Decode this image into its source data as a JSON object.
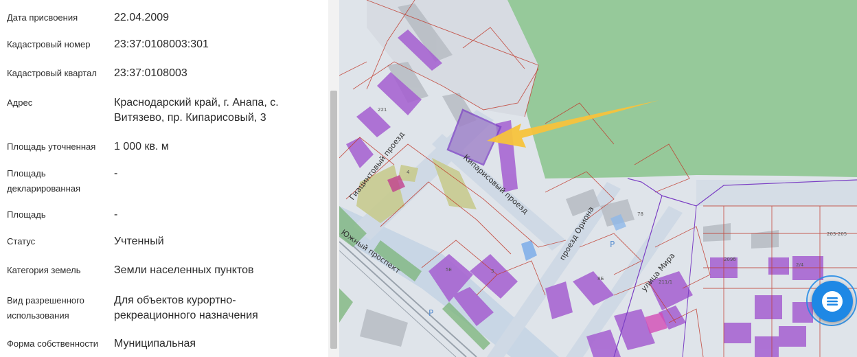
{
  "properties": [
    {
      "label": "Дата присвоения",
      "value": "22.04.2009"
    },
    {
      "label": "Кадастровый номер",
      "value": "23:37:0108003:301"
    },
    {
      "label": "Кадастровый квартал",
      "value": "23:37:0108003"
    },
    {
      "label": "Адрес",
      "value": "Краснодарский край, г. Анапа, с. Витязево, пр. Кипарисовый, 3"
    },
    {
      "label": "Площадь уточненная",
      "value": "1 000 кв. м"
    },
    {
      "label": "Площадь декларированная",
      "value": "-"
    },
    {
      "label": "Площадь",
      "value": "-"
    },
    {
      "label": "Статус",
      "value": "Учтенный"
    },
    {
      "label": "Категория земель",
      "value": "Земли населенных пунктов"
    },
    {
      "label": "Вид разрешенного использования",
      "value": "Для объектов курортно-рекреационного назначения"
    },
    {
      "label": "Форма собственности",
      "value": "Муниципальная"
    }
  ],
  "map": {
    "streets": {
      "giacint": "Гиацинтовый проезд",
      "kiparis": "Кипарисовый проезд",
      "yuzhny": "Южный проспект",
      "orion": "проезд Ориона",
      "mira": "улица Мира"
    },
    "parcel_numbers": [
      "221",
      "4",
      "5Е",
      "3",
      "78",
      "8Б",
      "211/1",
      "209б",
      "2/4",
      "203-205"
    ],
    "parking": [
      "Р",
      "Р"
    ],
    "colors": {
      "forest": "#96c99a",
      "building": "#a55fd1",
      "selected": "#7b3fc4",
      "arrow": "#f7c33c",
      "boundary": "#c0392b",
      "road": "#c8d6e5"
    }
  },
  "chat": {
    "icon": "chat-icon",
    "color": "#1e88e5"
  }
}
